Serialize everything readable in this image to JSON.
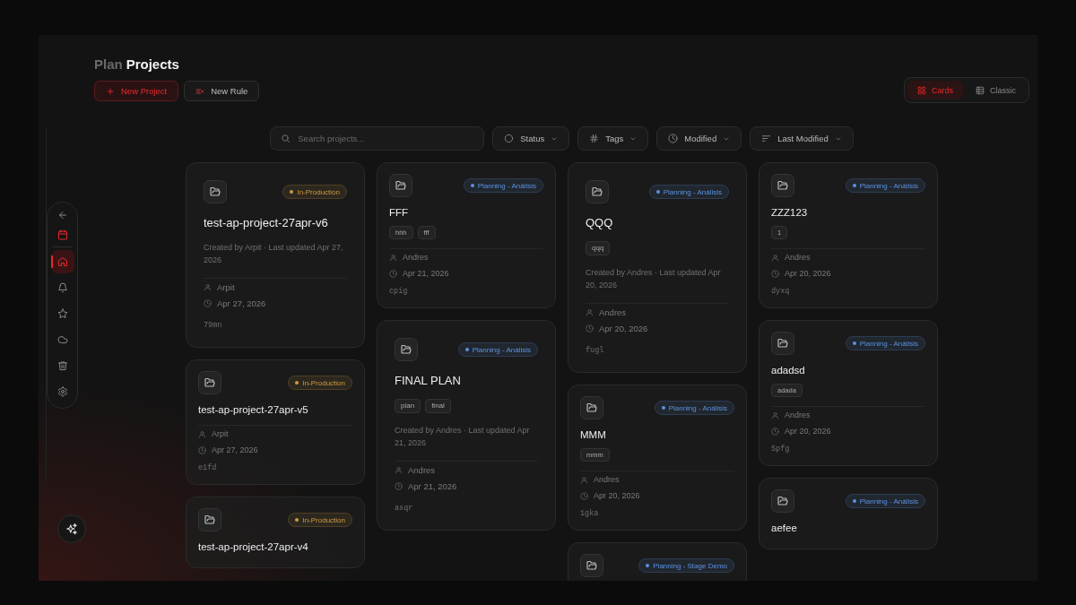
{
  "header": {
    "title_prefix": "Plan",
    "title": "Projects",
    "buttons": [
      {
        "kind": "primary",
        "label": "New Project"
      },
      {
        "kind": "secondary",
        "label": "New Rule"
      }
    ],
    "view_tabs": [
      {
        "label": "Cards",
        "selected": true
      },
      {
        "label": "Classic",
        "selected": false
      }
    ]
  },
  "sidebar": {
    "header_items": [
      {
        "kind": "back"
      },
      {
        "kind": "calendar"
      }
    ],
    "nav_items": [
      {
        "kind": "home",
        "selected": true
      },
      {
        "kind": "bell",
        "selected": false
      },
      {
        "kind": "star",
        "selected": false
      },
      {
        "kind": "cloud",
        "selected": false
      },
      {
        "kind": "trash",
        "selected": false
      },
      {
        "kind": "settings",
        "selected": false
      }
    ]
  },
  "filters": {
    "search": {
      "placeholder": "Search projects..."
    },
    "dropdowns": [
      {
        "kind": "status",
        "label": "Status"
      },
      {
        "kind": "tags",
        "label": "Tags"
      },
      {
        "kind": "date",
        "label": "Modified"
      },
      {
        "kind": "sort",
        "label": "Last Modified"
      }
    ]
  },
  "board": {
    "columns": [
      {
        "cards": [
          {
            "status": {
              "label": "In-Production",
              "color": "#d19a3e"
            },
            "title": "test-ap-project-27apr-v6",
            "description": "Created by Arpit · Last updated Apr 27, 2026",
            "owner": "Arpit",
            "date": "Apr 27, 2026",
            "code": "79mn"
          },
          {
            "status": {
              "label": "In-Production",
              "color": "#d19a3e"
            },
            "title": "test-ap-project-27apr-v5",
            "owner": "Arpit",
            "date": "Apr 27, 2026",
            "code": "e1fd"
          },
          {
            "status": {
              "label": "In-Production",
              "color": "#d19a3e"
            },
            "title": "test-ap-project-27apr-v4"
          }
        ]
      },
      {
        "cards": [
          {
            "status": {
              "label": "Planning - Análisis",
              "color": "#5b92e0"
            },
            "title": "FFF",
            "tags": [
              "hhh",
              "fff"
            ],
            "owner": "Andres",
            "date": "Apr 21, 2026",
            "code": "cpig"
          },
          {
            "status": {
              "label": "Planning - Análisis",
              "color": "#5b92e0"
            },
            "title": "FINAL PLAN",
            "tags": [
              "plan",
              "final"
            ],
            "description": "Created by Andres · Last updated Apr 21, 2026",
            "owner": "Andres",
            "date": "Apr 21, 2026",
            "code": "asqr"
          }
        ]
      },
      {
        "cards": [
          {
            "status": {
              "label": "Planning - Análisis",
              "color": "#5b92e0"
            },
            "title": "QQQ",
            "tags": [
              "qqq"
            ],
            "description": "Created by Andres · Last updated Apr 20, 2026",
            "owner": "Andres",
            "date": "Apr 20, 2026",
            "code": "fugl"
          },
          {
            "status": {
              "label": "Planning - Análisis",
              "color": "#5b92e0"
            },
            "title": "MMM",
            "tags": [
              "mmm"
            ],
            "owner": "Andres",
            "date": "Apr 20, 2026",
            "code": "1gka"
          },
          {
            "status": {
              "label": "Planning - Stage Demo",
              "color": "#5b92e0"
            }
          }
        ]
      },
      {
        "cards": [
          {
            "status": {
              "label": "Planning - Análisis",
              "color": "#5b92e0"
            },
            "title": "ZZZ123",
            "tags": [
              "1"
            ],
            "owner": "Andres",
            "date": "Apr 20, 2026",
            "code": "dyxq"
          },
          {
            "status": {
              "label": "Planning - Análisis",
              "color": "#5b92e0"
            },
            "title": "adadsd",
            "tags": [
              "adada"
            ],
            "owner": "Andres",
            "date": "Apr 20, 2026",
            "code": "5pfg"
          },
          {
            "status": {
              "label": "Planning - Análisis",
              "color": "#5b92e0"
            },
            "title": "aefee"
          }
        ]
      }
    ]
  }
}
